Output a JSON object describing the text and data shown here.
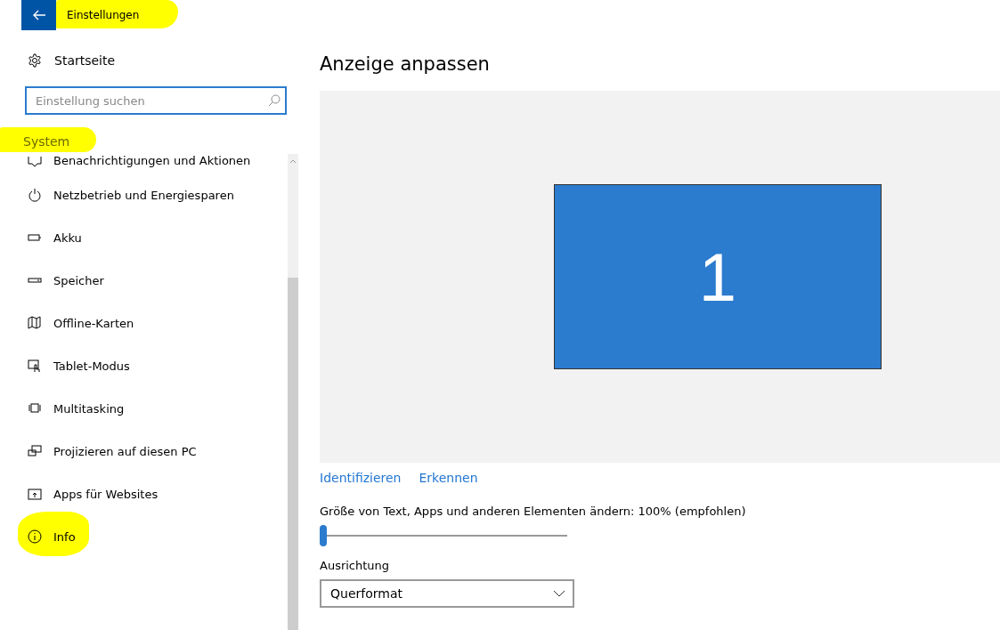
{
  "window": {
    "title": "Einstellungen",
    "highlighted": true
  },
  "sidebar": {
    "home": "Startseite",
    "search": {
      "placeholder": "Einstellung suchen"
    },
    "section": {
      "label": "System",
      "highlighted": true
    },
    "items": [
      {
        "label": "Benachrichtigungen und Aktionen",
        "highlighted": false
      },
      {
        "label": "Netzbetrieb und Energiesparen",
        "highlighted": false
      },
      {
        "label": "Akku",
        "highlighted": false
      },
      {
        "label": "Speicher",
        "highlighted": false
      },
      {
        "label": "Offline-Karten",
        "highlighted": false
      },
      {
        "label": "Tablet-Modus",
        "highlighted": false
      },
      {
        "label": "Multitasking",
        "highlighted": false
      },
      {
        "label": "Projizieren auf diesen PC",
        "highlighted": false
      },
      {
        "label": "Apps für Websites",
        "highlighted": false
      },
      {
        "label": "Info",
        "highlighted": true
      }
    ]
  },
  "content": {
    "title": "Anzeige anpassen",
    "displays": [
      {
        "label": "1",
        "selected": true
      }
    ],
    "links": [
      "Identifizieren",
      "Erkennen"
    ],
    "scale": {
      "label": "Größe von Text, Apps und anderen Elementen ändern: 100% (empfohlen)",
      "level": 0
    },
    "orientation": {
      "label": "Ausrichtung",
      "value": "Querformat"
    }
  }
}
